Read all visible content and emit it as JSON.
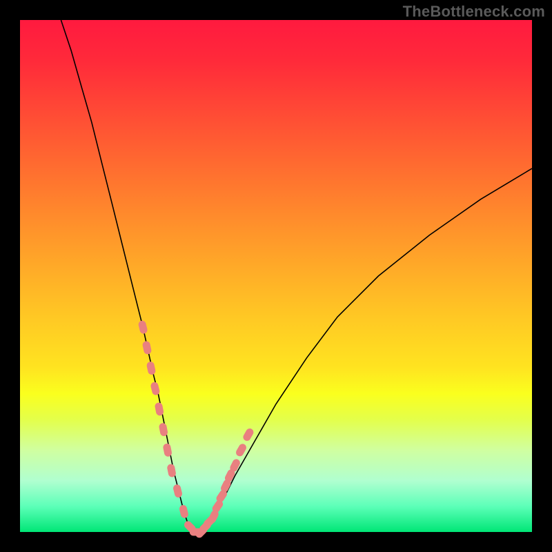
{
  "watermark": "TheBottleneck.com",
  "chart_data": {
    "type": "line",
    "title": "",
    "xlabel": "",
    "ylabel": "",
    "xlim": [
      0,
      100
    ],
    "ylim": [
      0,
      100
    ],
    "grid": false,
    "background_gradient": [
      "#ff1a3f",
      "#ff6a30",
      "#ffa928",
      "#ffe420",
      "#faff1e",
      "#d0ffa0",
      "#00e676"
    ],
    "series": [
      {
        "name": "bottleneck-curve",
        "x": [
          8,
          10,
          12,
          14,
          16,
          18,
          20,
          22,
          24,
          26,
          27,
          28,
          29,
          30,
          31,
          32,
          33,
          34,
          35,
          36,
          37,
          38,
          40,
          42,
          46,
          50,
          56,
          62,
          70,
          80,
          90,
          100
        ],
        "y": [
          100,
          94,
          87,
          80,
          72,
          64,
          56,
          48,
          40,
          31,
          27,
          22,
          17,
          12,
          8,
          4,
          1,
          0,
          0,
          1,
          2,
          4,
          7,
          11,
          18,
          25,
          34,
          42,
          50,
          58,
          65,
          71
        ]
      }
    ],
    "markers": {
      "name": "highlighted-points",
      "shape": "pill",
      "color": "#e98080",
      "points_x": [
        24.0,
        24.8,
        25.6,
        26.4,
        27.2,
        28.0,
        28.8,
        29.6,
        30.8,
        32.0,
        33.2,
        34.4,
        35.4,
        36.2,
        37.0,
        37.8,
        38.6,
        39.4,
        40.2,
        41.0,
        42.0,
        43.2,
        44.6
      ],
      "points_y": [
        40,
        36,
        32,
        28,
        24,
        20,
        16,
        12,
        8,
        4,
        1,
        0,
        0,
        1,
        2,
        3,
        5,
        7,
        9,
        11,
        13,
        16,
        19
      ]
    }
  }
}
